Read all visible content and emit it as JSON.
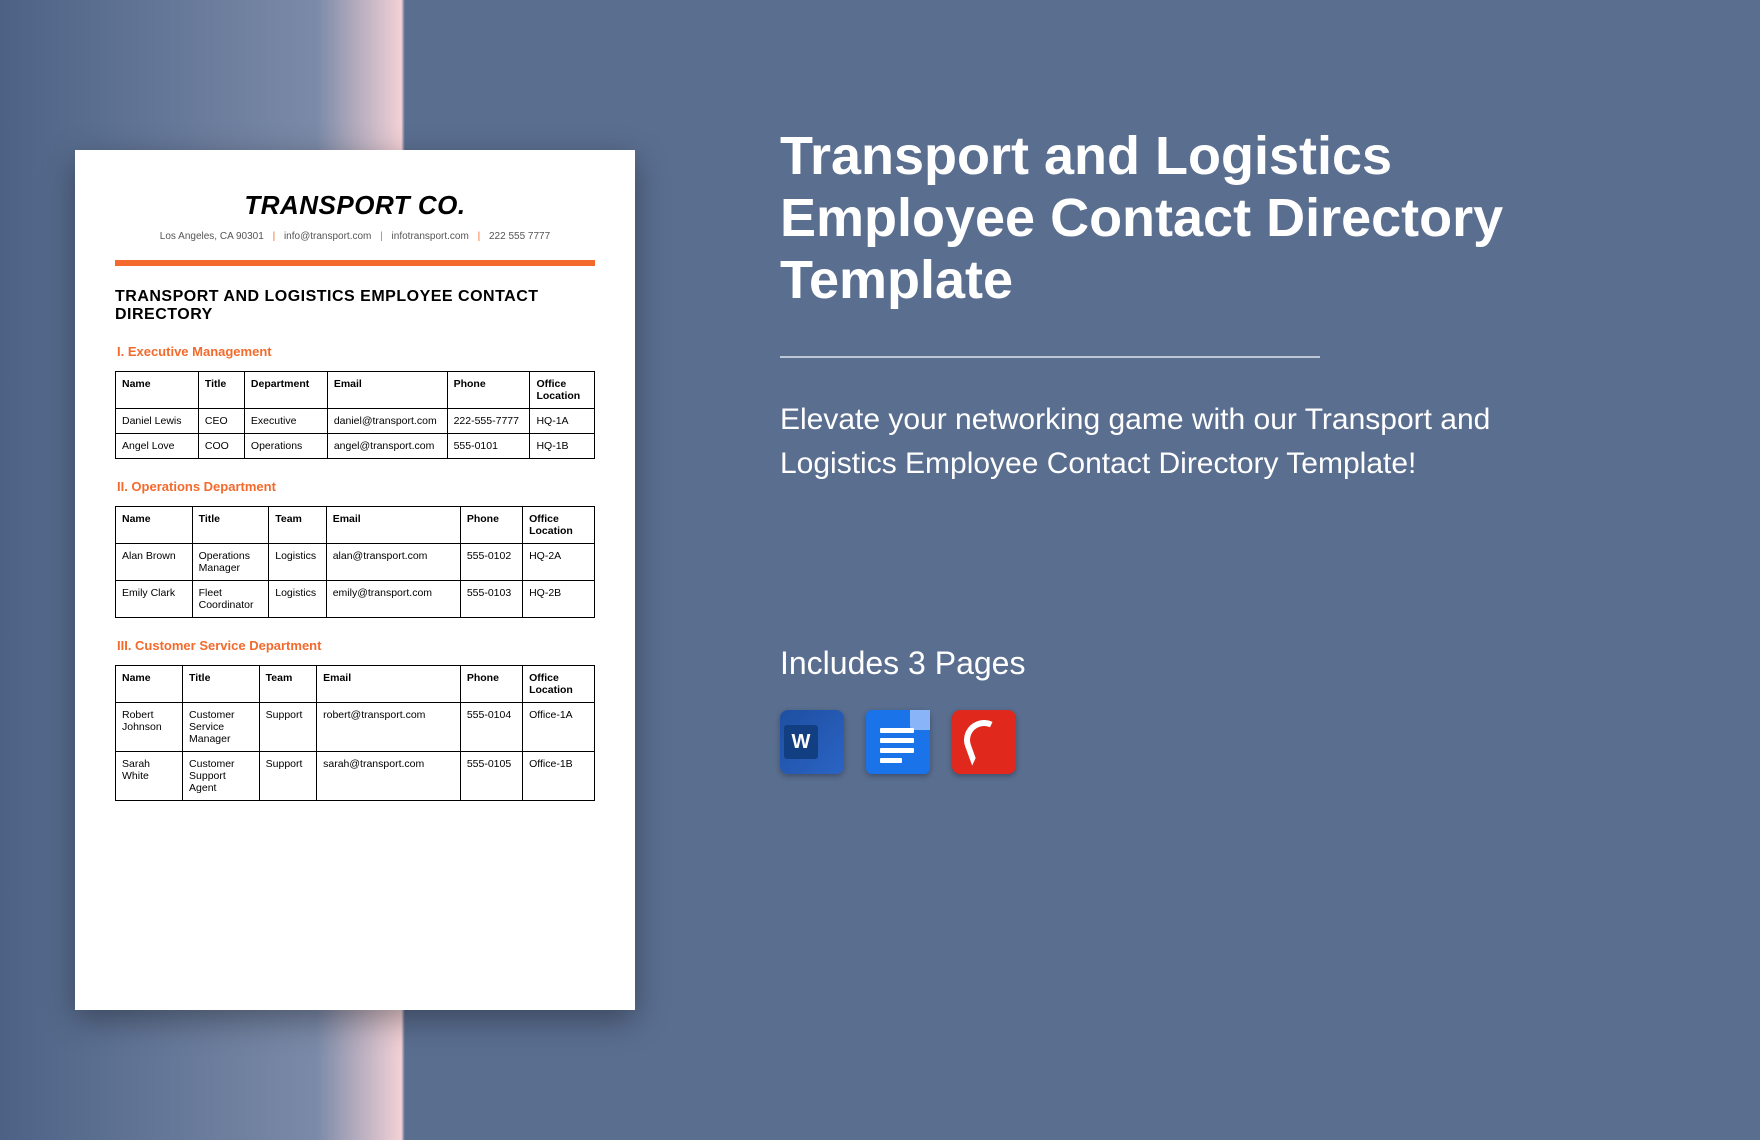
{
  "document": {
    "brand": "TRANSPORT CO.",
    "meta_address": "Los Angeles, CA 90301",
    "meta_email": "info@transport.com",
    "meta_site": "infotransport.com",
    "meta_phone": "222 555 7777",
    "title": "TRANSPORT AND LOGISTICS EMPLOYEE CONTACT DIRECTORY",
    "sections": [
      {
        "heading": "I.  Executive Management",
        "columns": [
          "Name",
          "Title",
          "Department",
          "Email",
          "Phone",
          "Office Location"
        ],
        "colwidths": [
          "18%",
          "10%",
          "18%",
          "26%",
          "18%",
          "14%"
        ],
        "rows": [
          [
            "Daniel Lewis",
            "CEO",
            "Executive",
            "daniel@transport.com",
            "222-555-7777",
            "HQ-1A"
          ],
          [
            "Angel Love",
            "COO",
            "Operations",
            "angel@transport.com",
            "555-0101",
            "HQ-1B"
          ]
        ]
      },
      {
        "heading": "II.   Operations Department",
        "columns": [
          "Name",
          "Title",
          "Team",
          "Email",
          "Phone",
          "Office Location"
        ],
        "colwidths": [
          "16%",
          "16%",
          "12%",
          "28%",
          "13%",
          "15%"
        ],
        "rows": [
          [
            "Alan Brown",
            "Operations Manager",
            "Logistics",
            "alan@transport.com",
            "555-0102",
            "HQ-2A"
          ],
          [
            "Emily Clark",
            "Fleet Coordinator",
            "Logistics",
            "emily@transport.com",
            "555-0103",
            "HQ-2B"
          ]
        ]
      },
      {
        "heading": "III.   Customer Service Department",
        "columns": [
          "Name",
          "Title",
          "Team",
          "Email",
          "Phone",
          "Office Location"
        ],
        "colwidths": [
          "14%",
          "16%",
          "12%",
          "30%",
          "13%",
          "15%"
        ],
        "rows": [
          [
            "Robert Johnson",
            "Customer Service Manager",
            "Support",
            "robert@transport.com",
            "555-0104",
            "Office-1A"
          ],
          [
            "Sarah White",
            "Customer Support Agent",
            "Support",
            "sarah@transport.com",
            "555-0105",
            "Office-1B"
          ]
        ]
      }
    ]
  },
  "right": {
    "title": "Transport and Logistics Employee Contact Directory Template",
    "blurb": "Elevate your networking game with our Transport and Logistics Employee Contact Directory Template!",
    "includes": "Includes 3 Pages"
  },
  "icons": {
    "word": "W",
    "gdoc": "gdoc",
    "pdf": "pdf"
  }
}
